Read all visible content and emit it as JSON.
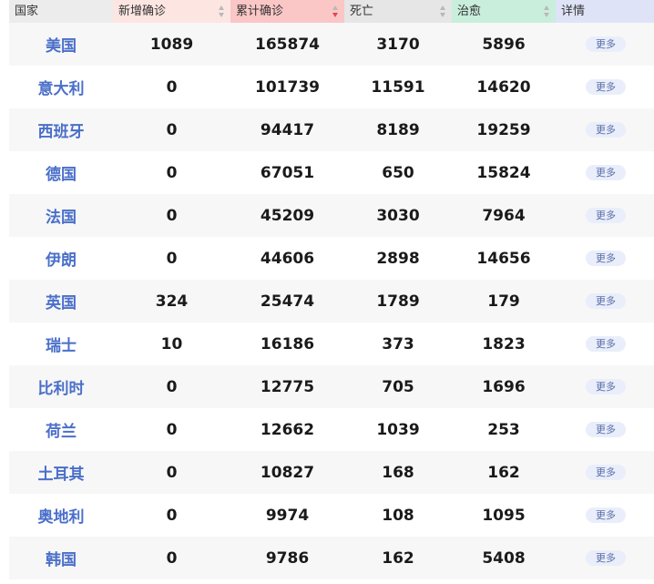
{
  "table": {
    "headers": [
      {
        "label": "国家",
        "bg": "#ececec",
        "sort": false,
        "active": false
      },
      {
        "label": "新增确诊",
        "bg": "#fde6e2",
        "sort": true,
        "active": false
      },
      {
        "label": "累计确诊",
        "bg": "#fbc6c6",
        "sort": true,
        "active": true
      },
      {
        "label": "死亡",
        "bg": "#e6e6e6",
        "sort": true,
        "active": false
      },
      {
        "label": "治愈",
        "bg": "#c9eedc",
        "sort": true,
        "active": false
      },
      {
        "label": "详情",
        "bg": "#dfe3f8",
        "sort": false,
        "active": false
      }
    ],
    "more_label": "更多",
    "rows": [
      {
        "country": "美国",
        "new": "1089",
        "total": "165874",
        "deaths": "3170",
        "cured": "5896"
      },
      {
        "country": "意大利",
        "new": "0",
        "total": "101739",
        "deaths": "11591",
        "cured": "14620"
      },
      {
        "country": "西班牙",
        "new": "0",
        "total": "94417",
        "deaths": "8189",
        "cured": "19259"
      },
      {
        "country": "德国",
        "new": "0",
        "total": "67051",
        "deaths": "650",
        "cured": "15824"
      },
      {
        "country": "法国",
        "new": "0",
        "total": "45209",
        "deaths": "3030",
        "cured": "7964"
      },
      {
        "country": "伊朗",
        "new": "0",
        "total": "44606",
        "deaths": "2898",
        "cured": "14656"
      },
      {
        "country": "英国",
        "new": "324",
        "total": "25474",
        "deaths": "1789",
        "cured": "179"
      },
      {
        "country": "瑞士",
        "new": "10",
        "total": "16186",
        "deaths": "373",
        "cured": "1823"
      },
      {
        "country": "比利时",
        "new": "0",
        "total": "12775",
        "deaths": "705",
        "cured": "1696"
      },
      {
        "country": "荷兰",
        "new": "0",
        "total": "12662",
        "deaths": "1039",
        "cured": "253"
      },
      {
        "country": "土耳其",
        "new": "0",
        "total": "10827",
        "deaths": "168",
        "cured": "162"
      },
      {
        "country": "奥地利",
        "new": "0",
        "total": "9974",
        "deaths": "108",
        "cured": "1095"
      },
      {
        "country": "韩国",
        "new": "0",
        "total": "9786",
        "deaths": "162",
        "cured": "5408"
      }
    ]
  }
}
